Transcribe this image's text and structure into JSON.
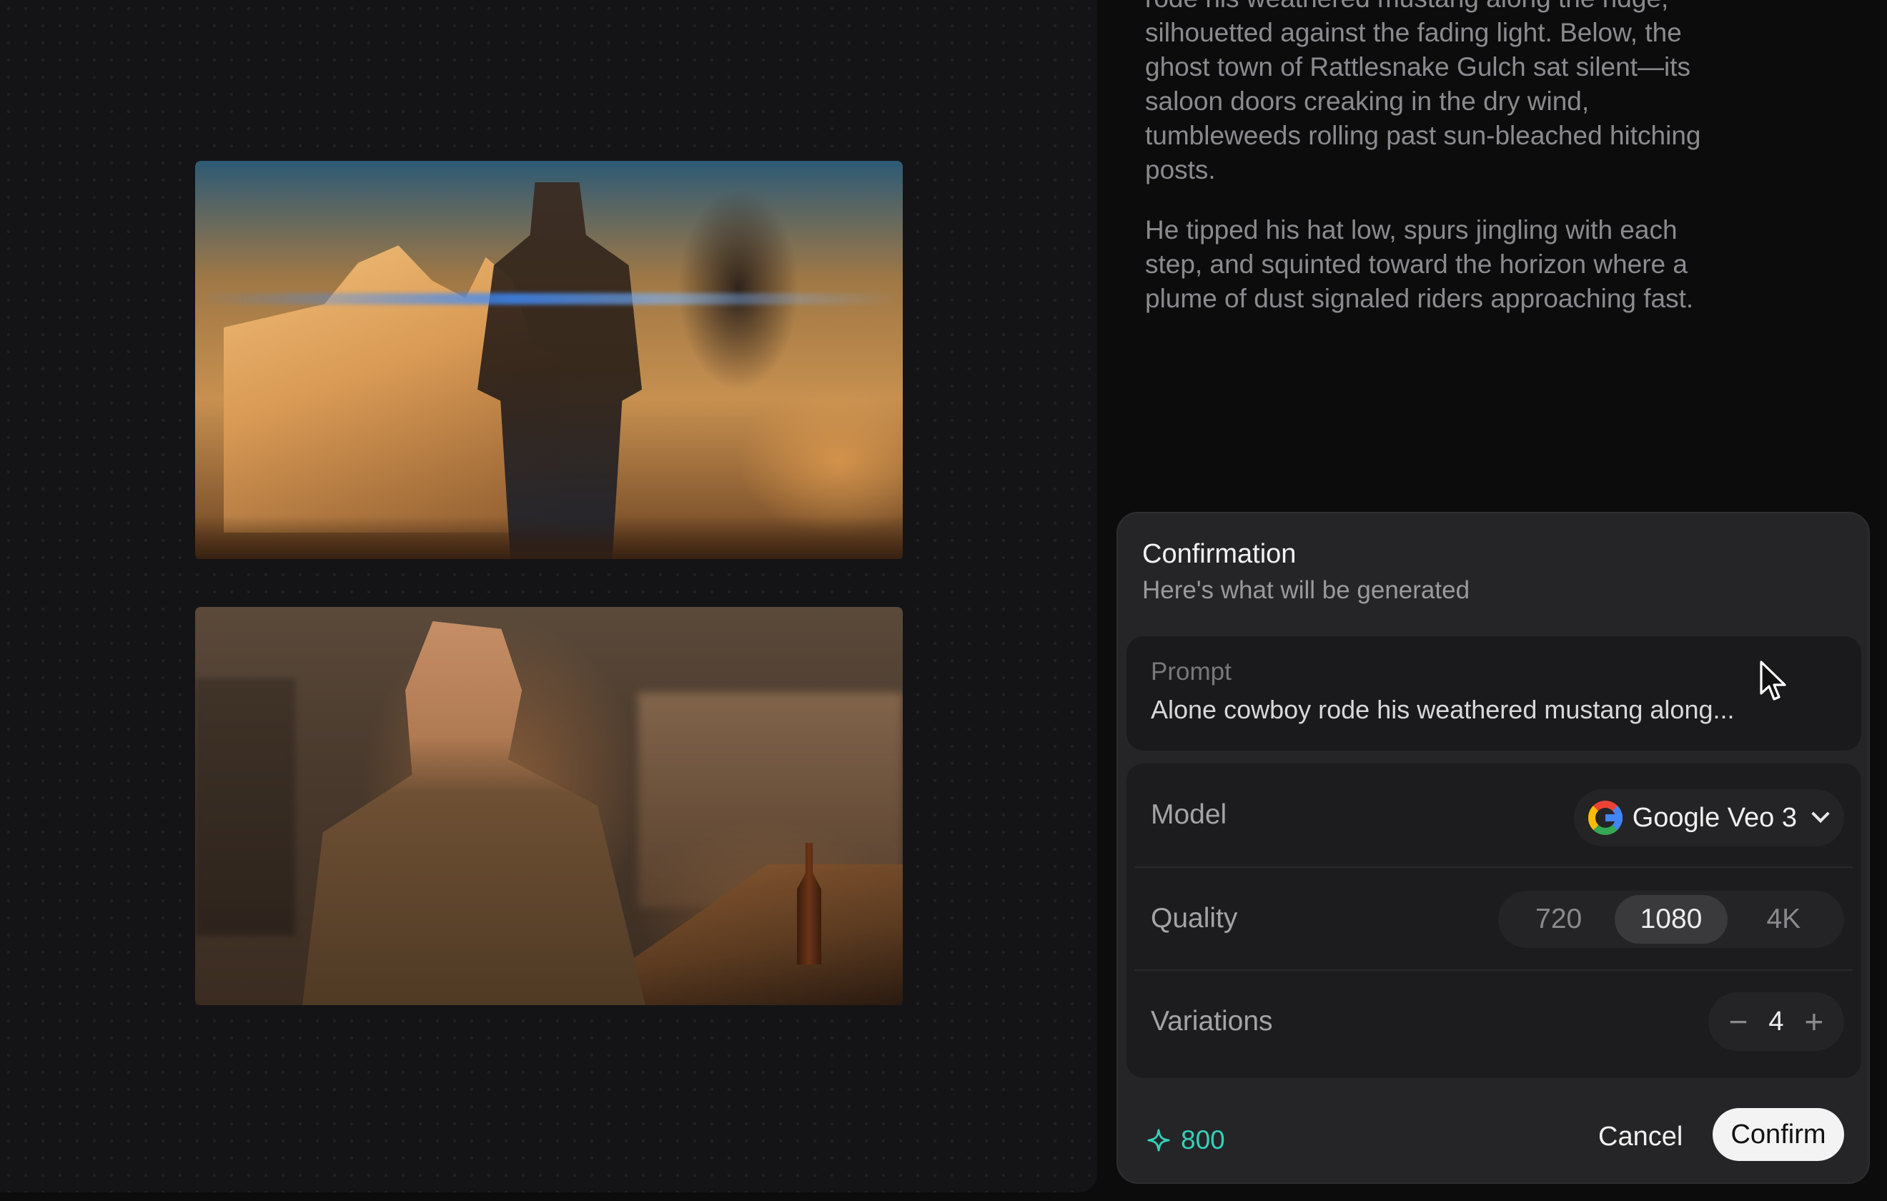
{
  "story": {
    "paragraph_1": "rode his weathered mustang along the ridge, silhouetted against the fading light. Below, the ghost town of Rattlesnake Gulch sat silent—its saloon doors creaking in the dry wind, tumbleweeds rolling past sun-bleached hitching posts.",
    "paragraph_2": "He tipped his hat low, spurs jingling with each step, and squinted toward the horizon where a plume of dust signaled riders approaching fast."
  },
  "confirmation": {
    "title": "Confirmation",
    "subtitle": "Here's what will be generated",
    "prompt": {
      "label": "Prompt",
      "text": "Alone cowboy rode his weathered mustang along..."
    },
    "model": {
      "label": "Model",
      "value": "Google Veo 3",
      "icon": "google-g-icon"
    },
    "quality": {
      "label": "Quality",
      "options": [
        "720",
        "1080",
        "4K"
      ],
      "selected": "1080"
    },
    "variations": {
      "label": "Variations",
      "value": "4",
      "decrement": "−",
      "increment": "+"
    },
    "credits": "800",
    "cancel_label": "Cancel",
    "confirm_label": "Confirm"
  },
  "colors": {
    "accent_credits": "#35d1b8",
    "panel_bg": "#252527",
    "confirm_bg": "#f3f3f3"
  }
}
